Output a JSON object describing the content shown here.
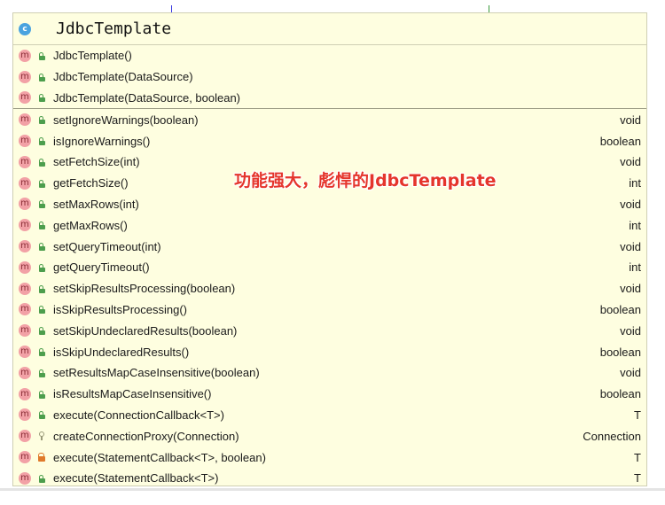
{
  "class_header": {
    "icon_letter": "c",
    "title": "JdbcTemplate"
  },
  "member_icon_letter": "m",
  "constructors": [
    {
      "name": "JdbcTemplate()"
    },
    {
      "name": "JdbcTemplate(DataSource)"
    },
    {
      "name": "JdbcTemplate(DataSource, boolean)"
    }
  ],
  "methods": [
    {
      "name": "setIgnoreWarnings(boolean)",
      "return_type": "void",
      "visibility": "public"
    },
    {
      "name": "isIgnoreWarnings()",
      "return_type": "boolean",
      "visibility": "public"
    },
    {
      "name": "setFetchSize(int)",
      "return_type": "void",
      "visibility": "public"
    },
    {
      "name": "getFetchSize()",
      "return_type": "int",
      "visibility": "public"
    },
    {
      "name": "setMaxRows(int)",
      "return_type": "void",
      "visibility": "public"
    },
    {
      "name": "getMaxRows()",
      "return_type": "int",
      "visibility": "public"
    },
    {
      "name": "setQueryTimeout(int)",
      "return_type": "void",
      "visibility": "public"
    },
    {
      "name": "getQueryTimeout()",
      "return_type": "int",
      "visibility": "public"
    },
    {
      "name": "setSkipResultsProcessing(boolean)",
      "return_type": "void",
      "visibility": "public"
    },
    {
      "name": "isSkipResultsProcessing()",
      "return_type": "boolean",
      "visibility": "public"
    },
    {
      "name": "setSkipUndeclaredResults(boolean)",
      "return_type": "void",
      "visibility": "public"
    },
    {
      "name": "isSkipUndeclaredResults()",
      "return_type": "boolean",
      "visibility": "public"
    },
    {
      "name": "setResultsMapCaseInsensitive(boolean)",
      "return_type": "void",
      "visibility": "public"
    },
    {
      "name": "isResultsMapCaseInsensitive()",
      "return_type": "boolean",
      "visibility": "public"
    },
    {
      "name": "execute(ConnectionCallback<T>)",
      "return_type": "T",
      "visibility": "public"
    },
    {
      "name": "createConnectionProxy(Connection)",
      "return_type": "Connection",
      "visibility": "package"
    },
    {
      "name": "execute(StatementCallback<T>, boolean)",
      "return_type": "T",
      "visibility": "private"
    },
    {
      "name": "execute(StatementCallback<T>)",
      "return_type": "T",
      "visibility": "public"
    }
  ],
  "overlay_text": "功能强大，彪悍的JdbcTemplate",
  "colors": {
    "panel_bg": "#fefee0",
    "class_icon": "#4aa3df",
    "method_icon": "#f2a1a6",
    "public_lock": "#4d9e4d",
    "private_lock": "#e07a2b",
    "overlay_text": "#e5352c"
  }
}
